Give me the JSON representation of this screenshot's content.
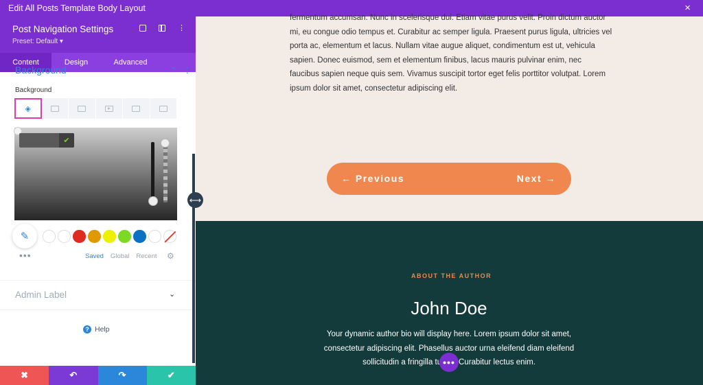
{
  "topbar": {
    "title": "Edit All Posts Template Body Layout",
    "close_icon": "×"
  },
  "panel": {
    "title": "Post Navigation Settings",
    "preset": "Preset: Default ▾",
    "tabs": [
      {
        "label": "Content"
      },
      {
        "label": "Design"
      },
      {
        "label": "Advanced"
      }
    ],
    "section_title": "Background",
    "section_tools": [
      "⌃",
      "⋮"
    ],
    "bg_label": "Background",
    "bg_types": [
      "color",
      "gradient",
      "image",
      "video",
      "pattern",
      "mask"
    ],
    "palette_tabs": [
      "Saved",
      "Global",
      "Recent"
    ],
    "swatches": [
      "#ffffff",
      "#ffffff",
      "#e02b20",
      "#e09900",
      "#edf000",
      "#7cda24",
      "#0c71c3",
      "#ffffff"
    ],
    "admin_label": "Admin Label",
    "admin_chevron": "⌄",
    "help": "Help",
    "help_icon": "?",
    "more_icon": "•••",
    "gear_icon": "⚙",
    "eyedropper_icon": "✎",
    "hex_ok_icon": "✔"
  },
  "bottombar": {
    "cancel": "✖",
    "undo": "↶",
    "redo": "↷",
    "save": "✔"
  },
  "resize_icon": "⟷",
  "content": {
    "body_text": "fermentum accumsan. Nunc in scelerisque dui. Etiam vitae purus velit. Proin dictum auctor mi, eu congue odio tempus et. Curabitur ac semper ligula. Praesent purus ligula, ultricies vel porta ac, elementum et lacus. Nullam vitae augue aliquet, condimentum est ut, vehicula sapien. Donec euismod, sem et elementum finibus, lacus mauris pulvinar enim, nec faucibus sapien neque quis sem. Vivamus suscipit tortor eget felis porttitor volutpat. Lorem ipsum dolor sit amet, consectetur adipiscing elit.",
    "prev": "← Previous",
    "next": "Next →",
    "author_tag": "ABOUT THE AUTHOR",
    "author_name": "John Doe",
    "author_bio": "Your dynamic author bio will display here. Lorem ipsum dolor sit amet, consectetur adipiscing elit. Phasellus auctor urna eleifend diam eleifend sollicitudin a fringilla turpis. Curabitur lectus enim.",
    "fab_icon": "•••"
  },
  "colors": {
    "primary": "#7b2fd0",
    "accent": "#2b87da",
    "nav": "#ef874f",
    "dark": "#133b3b",
    "cream": "#f3ebe5"
  }
}
